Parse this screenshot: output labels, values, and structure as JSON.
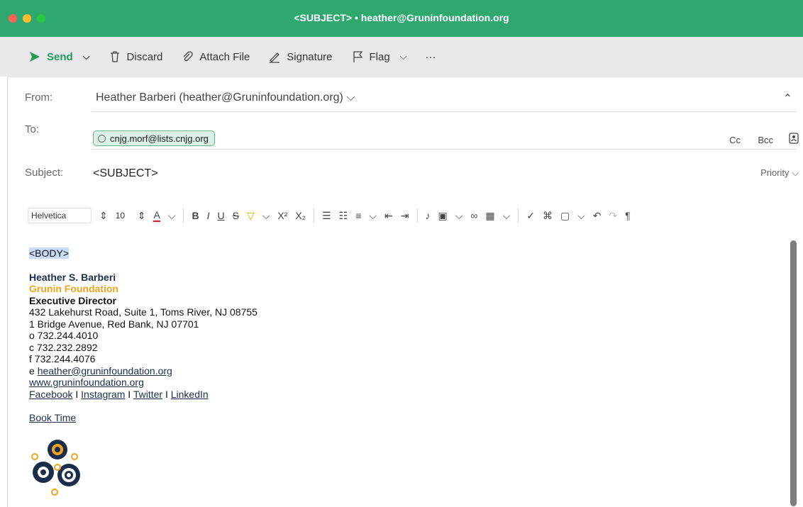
{
  "window": {
    "title": "<SUBJECT> • heather@Gruninfoundation.org"
  },
  "toolbar": {
    "send": "Send",
    "discard": "Discard",
    "attach": "Attach File",
    "signature": "Signature",
    "flag": "Flag",
    "more": "···"
  },
  "compose": {
    "from_label": "From:",
    "from_value": "Heather Barberi (heather@Gruninfoundation.org)",
    "to_label": "To:",
    "to_value": "cnjg.morf@lists.cnjg.org",
    "cc": "Cc",
    "bcc": "Bcc",
    "subject_label": "Subject:",
    "subject_value": "<SUBJECT>",
    "priority": "Priority"
  },
  "format": {
    "font": "Helvetica",
    "size": "10"
  },
  "body": {
    "placeholder": "<BODY>",
    "sig_name": "Heather S. Barberi",
    "sig_org": "Grunin Foundation",
    "sig_title": "Executive Director",
    "address1": "432 Lakehurst Road, Suite 1, Toms River, NJ 08755",
    "address2": "1 Bridge Avenue, Red Bank, NJ 07701",
    "phone_o": "o 732.244.4010",
    "phone_c": "c 732.232.2892",
    "fax": "f 732.244.4076",
    "email_prefix": "e ",
    "email": "heather@gruninfoundation.org",
    "website": "www.gruninfoundation.org",
    "social": [
      "Facebook",
      "Instagram",
      "Twitter",
      "LinkedIn"
    ],
    "sep": " I ",
    "book_time": "Book Time"
  },
  "colors": {
    "titlebar": "#2ea86e",
    "send": "#1f9b5d",
    "org": "#f0a31e",
    "chip_bg": "#d9f0e4"
  }
}
